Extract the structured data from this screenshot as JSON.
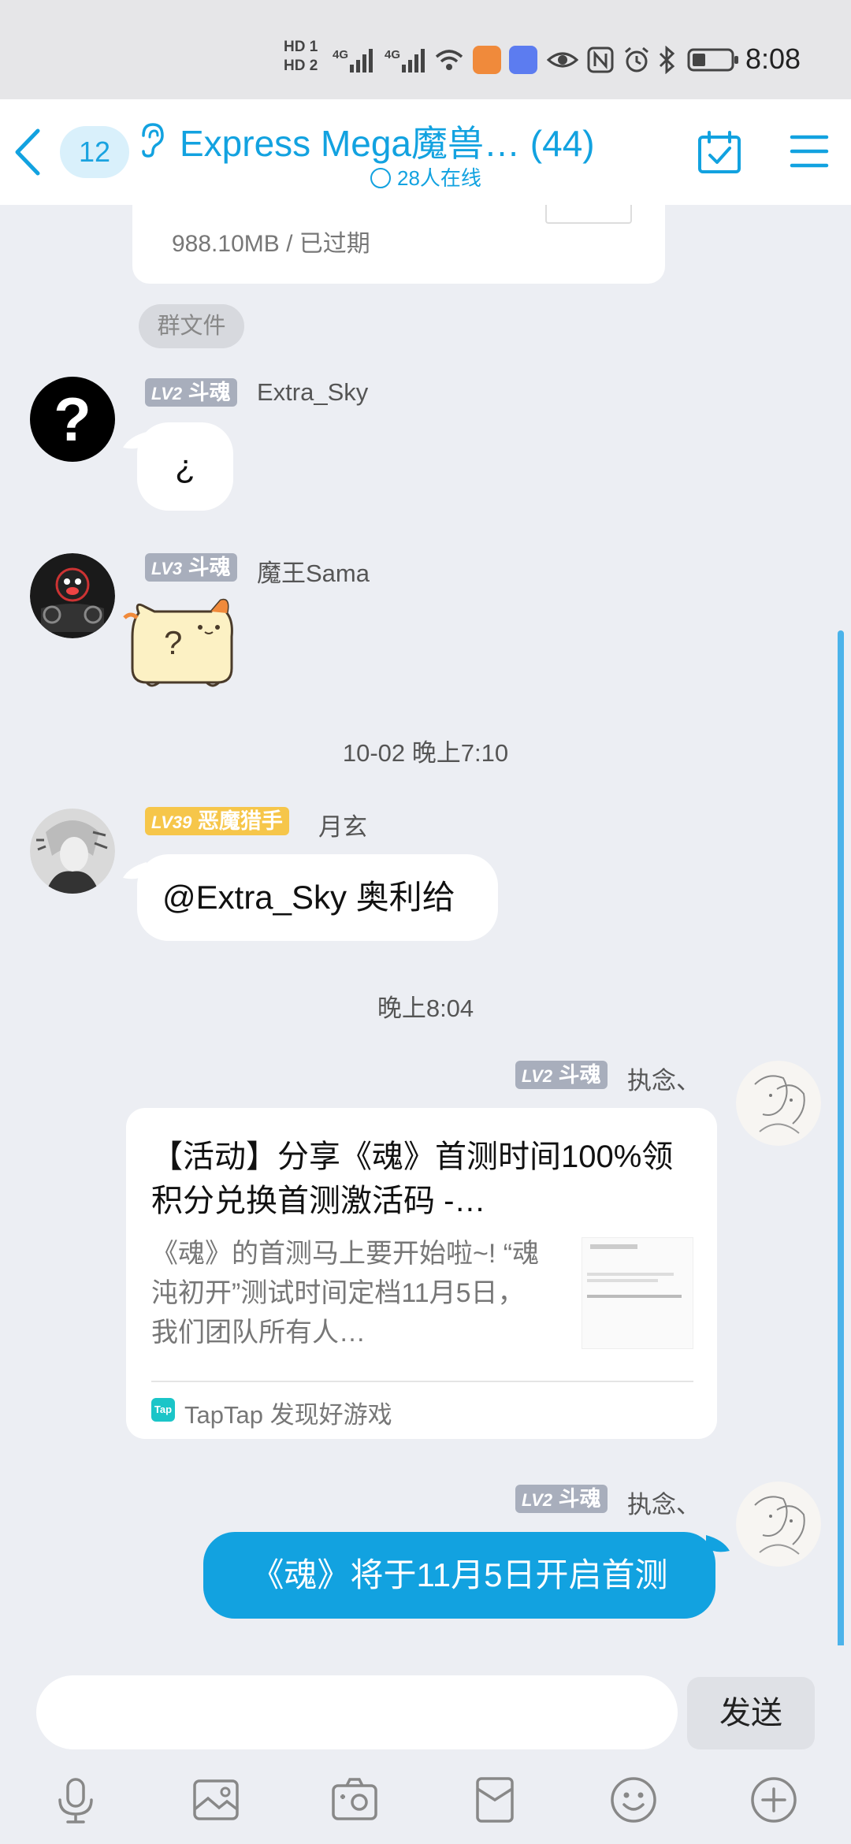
{
  "status_bar": {
    "hd_labels": [
      "HD 1",
      "HD 2"
    ],
    "network_labels": [
      "4G",
      "4G"
    ],
    "time": "8:08"
  },
  "header": {
    "unread_count": "12",
    "group_title": "Express Mega魔兽…",
    "member_count": "(44)",
    "online_text": "28人在线"
  },
  "chat": {
    "file": {
      "size_status": "988.10MB / 已过期",
      "tag": "群文件"
    },
    "messages": [
      {
        "level": "LV2",
        "title": "斗魂",
        "nickname": "Extra_Sky",
        "text": "¿",
        "avatar_glyph": "?"
      },
      {
        "level": "LV3",
        "title": "斗魂",
        "nickname": "魔王Sama",
        "sticker_glyph": "?"
      },
      {
        "level": "LV39",
        "title": "恶魔猎手",
        "nickname": "月玄",
        "text": "@Extra_Sky 奥利给"
      },
      {
        "level": "LV2",
        "title": "斗魂",
        "nickname": "执念、",
        "card": {
          "title": "【活动】分享《魂》首测时间100%领积分兑换首测激活码 -…",
          "desc": "《魂》的首测马上要开始啦~! “魂沌初开”测试时间定档11月5日，我们团队所有人…",
          "logo_text": "Tap",
          "source": "TapTap 发现好游戏"
        }
      },
      {
        "level": "LV2",
        "title": "斗魂",
        "nickname": "执念、",
        "text": "《魂》将于11月5日开启首测"
      }
    ],
    "time_separators": [
      "10-02 晚上7:10",
      "晚上8:04"
    ]
  },
  "input_bar": {
    "placeholder": "",
    "send_label": "发送"
  },
  "colors": {
    "accent": "#12a2e0",
    "level_gray": "#a8aebc",
    "level_gold": "#f6c64a",
    "background": "#eceef3"
  },
  "icons": [
    "back-icon",
    "ear-icon",
    "calendar-check-icon",
    "menu-icon",
    "microphone-icon",
    "image-icon",
    "camera-icon",
    "red-packet-icon",
    "emoji-icon",
    "plus-icon"
  ]
}
